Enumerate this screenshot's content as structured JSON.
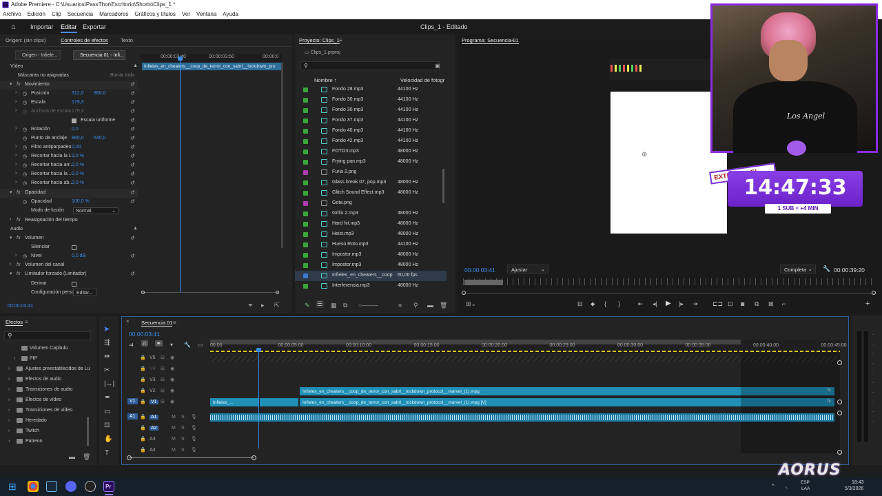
{
  "window": {
    "title": "Adobe Premiere - C:\\Usuarios\\PassThor\\Escritorio\\Shorts\\Clips_1 *"
  },
  "menu": [
    "Archivo",
    "Edición",
    "Clip",
    "Secuencia",
    "Marcadores",
    "Gráficos y títulos",
    "Ver",
    "Ventana",
    "Ayuda"
  ],
  "workspace": {
    "tabs": [
      "Importar",
      "Editar",
      "Exportar"
    ],
    "active": "Editar",
    "doc_title": "Clips_1 - Editado"
  },
  "effect_controls": {
    "tabs": [
      "Origen: (sin clips)",
      "Controles de efectos",
      "Texto"
    ],
    "sub_tabs": [
      "Origen - Infiele...",
      "Secuencia 01 - Infi..."
    ],
    "ruler": [
      "00:00:03:40",
      "00:00:03:50",
      "00:00:0"
    ],
    "clip_name": "Infieles_en_cheaters__coop_de_terror_con_sabri__lockdown_pro",
    "section_video": "Vídeo",
    "masks": "Máscaras no asignadas",
    "clear_time": "Borrar todo",
    "motion": "Movimiento",
    "position": {
      "label": "Posición",
      "x": "312,0",
      "y": "960,0"
    },
    "scale": {
      "label": "Escala",
      "value": "179,3"
    },
    "scale_width": {
      "label": "Anchura de escala",
      "value": "179,3"
    },
    "uniform": "Escala uniforme",
    "rotation": {
      "label": "Rotación",
      "value": "0,0"
    },
    "anchor": {
      "label": "Punto de anclaje",
      "x": "960,0",
      "y": "540,0"
    },
    "antiflicker": {
      "label": "Filtro antiparpadeo",
      "value": "0,00"
    },
    "crop": [
      {
        "label": "Recortar hacia la i...",
        "value": "0,0 %"
      },
      {
        "label": "Recortar hacia arr...",
        "value": "0,0 %"
      },
      {
        "label": "Recortar hacia la ...",
        "value": "0,0 %"
      },
      {
        "label": "Recortar hacia ab...",
        "value": "0,0 %"
      }
    ],
    "opacity_section": "Opacidad",
    "opacity": {
      "label": "Opacidad",
      "value": "100,0 %"
    },
    "blend": {
      "label": "Modo de fusión",
      "value": "Normal"
    },
    "time_remap": "Reasignación del tiempo",
    "section_audio": "Audio",
    "volume": "Volumen",
    "mute": "Silenciar",
    "level": {
      "label": "Nivel",
      "value": "0,0 dB"
    },
    "channel_volume": "Volumen del canal",
    "limiter": "Limitador forzado (Limitador)",
    "bypass": "Derivar",
    "config": {
      "label": "Configuración perso",
      "button": "Editar..."
    },
    "timecode": "00:00:03:41"
  },
  "project": {
    "tab": "Proyecto: Clips_1",
    "file": "Clips_1.prproj",
    "col_name": "Nombre",
    "col_rate": "Velocidad de fotogr",
    "items": [
      {
        "name": "Fondo 28.mp3",
        "rate": "44100 Hz",
        "color": "#3aa53a"
      },
      {
        "name": "Fondo 30.mp3",
        "rate": "44100 Hz",
        "color": "#3aa53a"
      },
      {
        "name": "Fondo 30.mp3",
        "rate": "44100 Hz",
        "color": "#3aa53a"
      },
      {
        "name": "Fondo 37.mp3",
        "rate": "44100 Hz",
        "color": "#3aa53a"
      },
      {
        "name": "Fondo 40.mp3",
        "rate": "44100 Hz",
        "color": "#3aa53a"
      },
      {
        "name": "Fondo 42.mp3",
        "rate": "44100 Hz",
        "color": "#3aa53a"
      },
      {
        "name": "FOTO3.mp3",
        "rate": "48000 Hz",
        "color": "#3aa53a"
      },
      {
        "name": "Frying pan.mp3",
        "rate": "48000 Hz",
        "color": "#3aa53a"
      },
      {
        "name": "Furia 2.png",
        "rate": "",
        "color": "#b03ab0"
      },
      {
        "name": "Glass break 07, pop.mp3",
        "rate": "48000 Hz",
        "color": "#3aa53a"
      },
      {
        "name": "Glitch Sound Effect.mp3",
        "rate": "48000 Hz",
        "color": "#3aa53a"
      },
      {
        "name": "Gota.png",
        "rate": "",
        "color": "#b03ab0"
      },
      {
        "name": "Grillo 2.mp3",
        "rate": "48000 Hz",
        "color": "#3aa53a"
      },
      {
        "name": "Hard hit.mp3",
        "rate": "48000 Hz",
        "color": "#3aa53a"
      },
      {
        "name": "Heist.mp3",
        "rate": "48000 Hz",
        "color": "#3aa53a"
      },
      {
        "name": "Hueso Roto.mp3",
        "rate": "44100 Hz",
        "color": "#3aa53a"
      },
      {
        "name": "Impostor.mp3",
        "rate": "48000 Hz",
        "color": "#3aa53a"
      },
      {
        "name": "Impostor.mp3",
        "rate": "48000 Hz",
        "color": "#3aa53a"
      },
      {
        "name": "Infieles_en_cheaters__coop",
        "rate": "60,00 fps",
        "color": "#3a7ad0"
      },
      {
        "name": "Interferencia.mp3",
        "rate": "48000 Hz",
        "color": "#3aa53a"
      }
    ]
  },
  "program": {
    "tab": "Programa: Secuencia 01",
    "timecode": "00:00:03:41",
    "fit": "Ajustar",
    "quality": "Completa",
    "duration": "00:00:39:20"
  },
  "overlay": {
    "badge": "EXTENSIBLE!",
    "timer": "14:47:33",
    "sub_rule": "1 SUB = +4 MIN",
    "cam_text": "Los Angel"
  },
  "effects": {
    "tab": "Efectos",
    "items": [
      "Volumen Capítulo",
      "PIP",
      "Ajustes preestablecidos de Lu",
      "Efectos de audio",
      "Transiciones de audio",
      "Efectos de vídeo",
      "Transiciones de vídeo",
      "Heredado",
      "Twitch",
      "Patreon"
    ]
  },
  "timeline": {
    "tab": "Secuencia 01",
    "timecode": "00:00:03:41",
    "ruler": [
      "00:00",
      "00:00:05:00",
      "00:00:10:00",
      "00:00:15:00",
      "00:00:20:00",
      "00:00:25:00",
      "00:00:30:00",
      "00:00:35:00",
      "00:00:40:00",
      "00:00:45:00"
    ],
    "video_tracks": [
      "V5",
      "V4",
      "V3",
      "V2",
      "V1"
    ],
    "audio_tracks": [
      "A1",
      "A2",
      "A3",
      "A4"
    ],
    "clip_v2": "Infieles_en_cheaters__coop_de_terror_con_sabri__lockdown_protocol__marvel_(1).mpg",
    "clip_v1": "Infieles_en_cheaters__coop_de_terror_con_sabri__lockdown_protocol__marvel_(1).mpg [V]",
    "clip_v1_short": "Infieles_..."
  },
  "taskbar": {
    "lang": "ESP",
    "region": "LAA",
    "time": "18:43",
    "date": "5/3/2026",
    "brand": "AORUS"
  }
}
